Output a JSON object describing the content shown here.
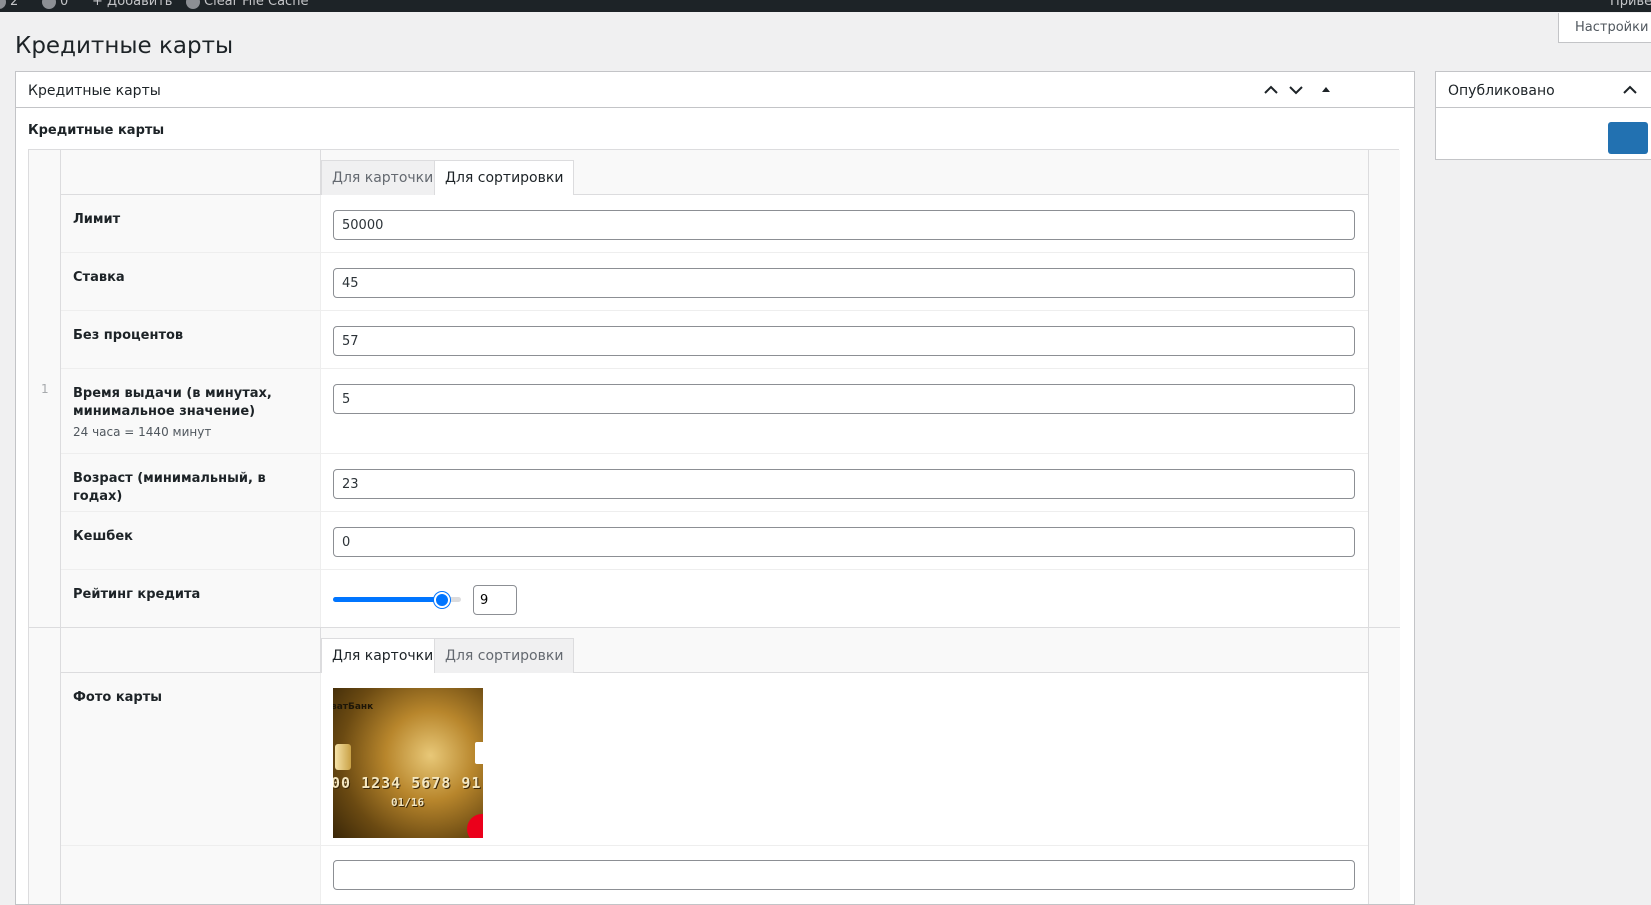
{
  "adminbar": {
    "comments_count": "2",
    "messages_count": "0",
    "new_label": "Добавить",
    "cache_label": "Clear File Cache",
    "greeting": "Приве"
  },
  "screen_options": {
    "label": "Настройки э"
  },
  "page": {
    "title": "Кредитные карты"
  },
  "metabox": {
    "title": "Кредитные карты",
    "field_label": "Кредитные карты",
    "row_number": "1",
    "tabs1": [
      {
        "label": "Для карточки",
        "active": false
      },
      {
        "label": "Для сортировки",
        "active": true
      }
    ],
    "tabs2": [
      {
        "label": "Для карточки",
        "active": true
      },
      {
        "label": "Для сортировки",
        "active": false
      }
    ],
    "fields": {
      "limit": {
        "label": "Лимит",
        "value": "50000"
      },
      "rate": {
        "label": "Ставка",
        "value": "45"
      },
      "no_interest": {
        "label": "Без процентов",
        "value": "57"
      },
      "issue_time": {
        "label": "Время выдачи (в минутах, минимальное значение)",
        "description": "24 часа = 1440 минут",
        "value": "5"
      },
      "age": {
        "label": "Возраст (минимальный, в годах)",
        "value": "23"
      },
      "cashback": {
        "label": "Кешбек",
        "value": "0"
      },
      "rating": {
        "label": "Рейтинг кредита",
        "value": "9",
        "min": 0,
        "max": 10
      },
      "photo": {
        "label": "Фото карты"
      }
    },
    "card_image": {
      "bank_text": "ватБанк",
      "number_text": "00 1234 5678 91",
      "expiry_text": "01/16"
    }
  },
  "publish_box": {
    "title": "Опубликовано"
  },
  "colors": {
    "accent": "#0075ff",
    "primary_button": "#2271b1",
    "adminbar": "#1d2327"
  }
}
